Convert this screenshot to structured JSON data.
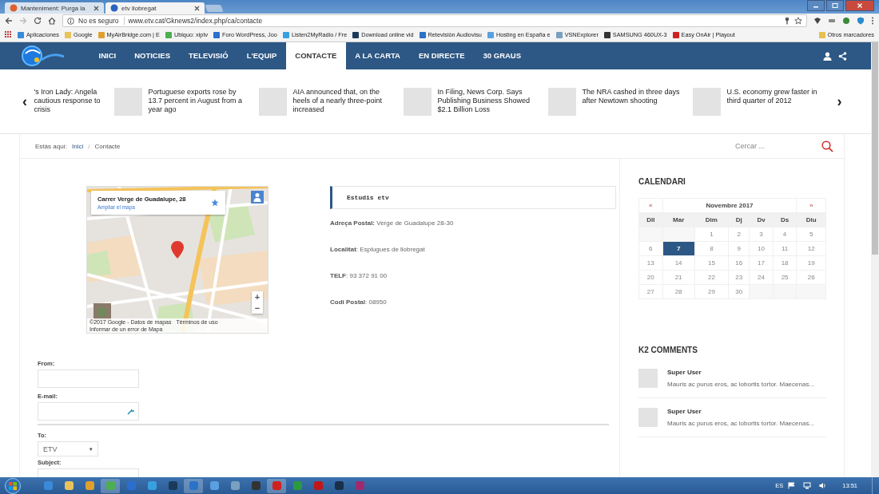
{
  "browser": {
    "tabs": [
      {
        "title": "Manteniment: Purga la",
        "selected": false
      },
      {
        "title": "etv llobregat",
        "selected": true
      }
    ],
    "security": "No es seguro",
    "url": "www.etv.cat/Gknews2/index.php/ca/contacte",
    "bookmarks": [
      "Aplicaciones",
      "Google",
      "MyAirBridge.com | E",
      "Ubiquo: xiptv",
      "Foro WordPress, Joo",
      "Listen2MyRadio / Fre",
      "Download online vid",
      "Retevisión Audiovisu",
      "Hosting en España e",
      "VSNExplorer",
      "SAMSUNG 460UX-3",
      "Easy OnAir | Playout"
    ],
    "other_bookmarks": "Otros marcadores"
  },
  "site": {
    "nav": [
      {
        "label": "INICI",
        "selected": false
      },
      {
        "label": "NOTICIES",
        "selected": false
      },
      {
        "label": "TELEVISIÓ",
        "selected": false
      },
      {
        "label": "L'EQUIP",
        "selected": false
      },
      {
        "label": "CONTACTE",
        "selected": true
      },
      {
        "label": "A LA CARTA",
        "selected": false
      },
      {
        "label": "EN DIRECTE",
        "selected": false
      },
      {
        "label": "30 GRAUS",
        "selected": false
      }
    ]
  },
  "ticker": {
    "prev": "‹",
    "next": "›",
    "items": [
      {
        "text": "'s Iron Lady: Angela cautious response to crisis",
        "thumbnail": false
      },
      {
        "text": "Portuguese exports rose by 13.7 percent in August from a year ago",
        "thumbnail": true
      },
      {
        "text": "AIA announced that, on the heels of a nearly three-point increased",
        "thumbnail": true
      },
      {
        "text": "In Filing, News Corp. Says Publishing Business Showed $2.1 Billion Loss",
        "thumbnail": true
      },
      {
        "text": "The NRA cashed in three days after Newtown shooting",
        "thumbnail": true
      },
      {
        "text": "U.S. economy grew faster in third quarter of 2012",
        "thumbnail": true
      }
    ]
  },
  "breadcrumb": {
    "prefix": "Estàs aquí:",
    "items": [
      "Inici",
      "Contacte"
    ],
    "separator": "/"
  },
  "search": {
    "placeholder": "Cercar ..."
  },
  "map": {
    "place": "Carrer Verge de Guadalupe, 28",
    "link": "Ampliar el mapa",
    "zoom_in": "+",
    "zoom_out": "−",
    "footer": [
      "©2017 Google - Datos de mapas",
      "Términos de uso",
      "Informar de un error de Mapa"
    ]
  },
  "contact": {
    "heading": "Estudis etv",
    "lines": [
      "**Adreça Postal:** Verge de Guadalupe 28-30",
      "**Localitat**: Esplugues de llobregat",
      "**TELF**: 93 372 91 00",
      "**Codi Postal**: 08950"
    ]
  },
  "calendar": {
    "title": "CALENDARI",
    "prev": "«",
    "next": "»",
    "month": "Novembre 2017",
    "weekdays": [
      "Dll",
      "Mar",
      "Dim",
      "Dj",
      "Dv",
      "Ds",
      "Diu"
    ],
    "weeks": [
      [
        {
          "kind": "blank"
        },
        {
          "kind": "blank"
        },
        {
          "day": "1",
          "selected": false
        },
        {
          "day": "2",
          "selected": false
        },
        {
          "day": "3",
          "selected": false
        },
        {
          "day": "4",
          "selected": false
        },
        {
          "day": "5",
          "selected": false
        }
      ],
      [
        {
          "day": "6",
          "selected": false
        },
        {
          "day": "7",
          "selected": true
        },
        {
          "day": "8",
          "selected": false
        },
        {
          "day": "9",
          "selected": false
        },
        {
          "day": "10",
          "selected": false
        },
        {
          "day": "11",
          "selected": false
        },
        {
          "day": "12",
          "selected": false
        }
      ],
      [
        {
          "day": "13",
          "selected": false
        },
        {
          "day": "14",
          "selected": false
        },
        {
          "day": "15",
          "selected": false
        },
        {
          "day": "16",
          "selected": false
        },
        {
          "day": "17",
          "selected": false
        },
        {
          "day": "18",
          "selected": false
        },
        {
          "day": "19",
          "selected": false
        }
      ],
      [
        {
          "day": "20",
          "selected": false
        },
        {
          "day": "21",
          "selected": false
        },
        {
          "day": "22",
          "selected": false
        },
        {
          "day": "23",
          "selected": false
        },
        {
          "day": "24",
          "selected": false
        },
        {
          "day": "25",
          "selected": false
        },
        {
          "day": "26",
          "selected": false
        }
      ],
      [
        {
          "day": "27",
          "selected": false
        },
        {
          "day": "28",
          "selected": false
        },
        {
          "day": "29",
          "selected": false
        },
        {
          "day": "30",
          "selected": false
        },
        {
          "kind": "blank"
        },
        {
          "kind": "blank"
        },
        {
          "kind": "blank"
        }
      ]
    ]
  },
  "comments": {
    "title": "K2 COMMENTS",
    "items": [
      {
        "author": "Super User",
        "text": "Mauris ac purus eros, ac lobortis tortor. Maecenas..."
      },
      {
        "author": "Super User",
        "text": "Mauris ac purus eros, ac lobortis tortor. Maecenas..."
      }
    ]
  },
  "form": {
    "sender_fields": [
      {
        "kind": "text",
        "label": "From:"
      },
      {
        "kind": "email",
        "label": "E-mail:"
      }
    ],
    "to": {
      "label": "To:",
      "value": "ETV",
      "caret": "▾"
    },
    "subject": {
      "label": "Subject:"
    }
  },
  "taskbar": {
    "language": "ES",
    "time": "13:51"
  }
}
